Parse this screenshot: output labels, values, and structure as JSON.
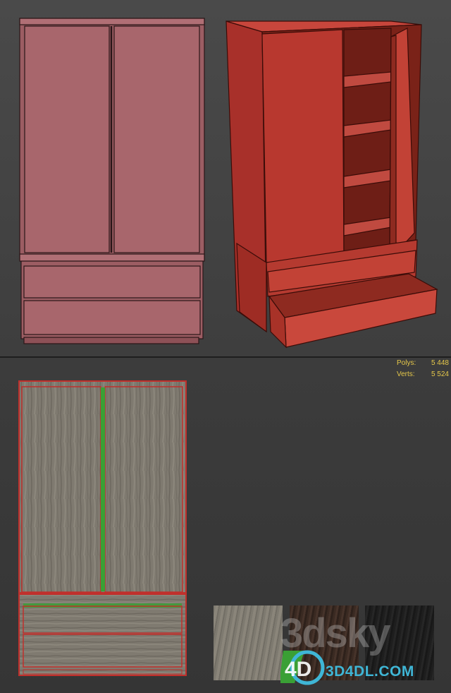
{
  "stats": {
    "polys_label": "Polys:",
    "polys_value": "5 448",
    "verts_label": "Verts:",
    "verts_value": "5 524"
  },
  "colors": {
    "background": "#3a3a3a",
    "stats_text": "#e6c84a",
    "front_view_body": "#a8666c",
    "perspective_body": "#b83a30",
    "uv_outline": "#c0302c",
    "uv_seam": "#3aa035",
    "watermark_site": "#3fb6d6"
  },
  "materials": [
    "light-grey-wood",
    "dark-brown-wood",
    "black-wood"
  ],
  "watermark": {
    "text": "3dsky",
    "site": "3D4DL.COM",
    "logo": "4D"
  }
}
